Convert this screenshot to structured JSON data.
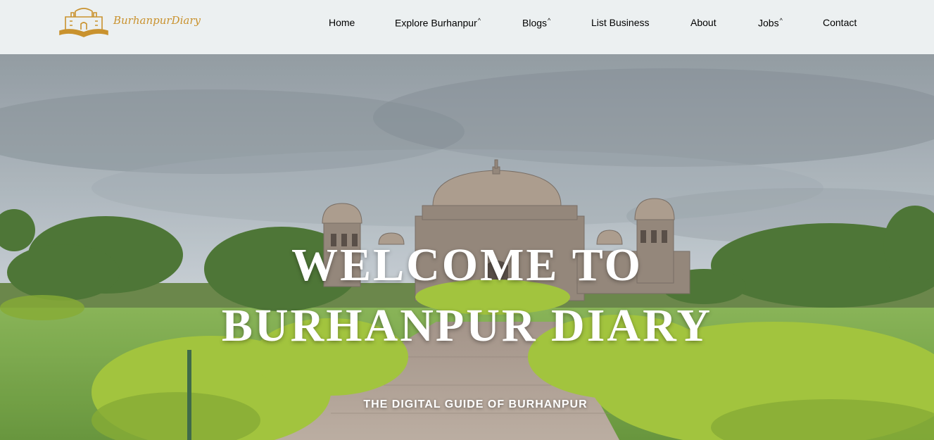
{
  "brand": {
    "name": "BurhanpurDiary",
    "logo_icon": "book-palace-icon",
    "color": "#c9922e"
  },
  "nav": {
    "items": [
      {
        "label": "Home",
        "caret": ""
      },
      {
        "label": "Explore Burhanpur",
        "caret": "^"
      },
      {
        "label": "Blogs",
        "caret": "^"
      },
      {
        "label": "List Business",
        "caret": ""
      },
      {
        "label": "About",
        "caret": ""
      },
      {
        "label": "Jobs",
        "caret": "^"
      },
      {
        "label": "Contact",
        "caret": ""
      }
    ]
  },
  "hero": {
    "title_line1": "WELCOME TO",
    "title_line2": "BURHANPUR DIARY",
    "subtitle": "THE DIGITAL GUIDE OF BURHANPUR"
  },
  "colors": {
    "header_bg": "#ecf0f1",
    "brand_gold": "#c9922e",
    "hero_text": "#ffffff"
  }
}
